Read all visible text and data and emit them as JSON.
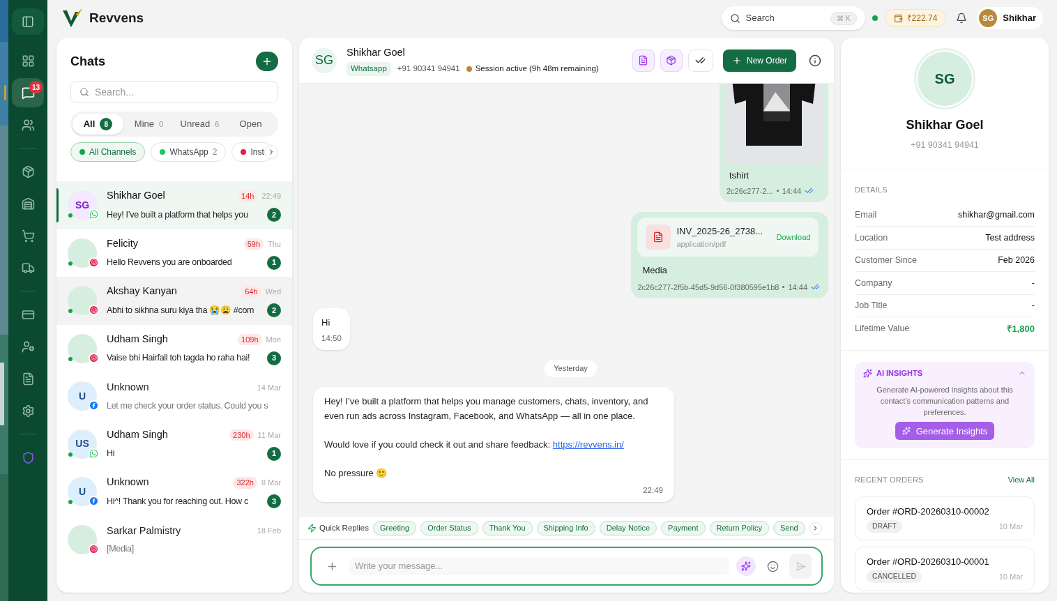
{
  "brand": {
    "name": "Revvens"
  },
  "nav": {
    "groups": [
      [
        {
          "kind": "dashboard",
          "selected": false
        },
        {
          "kind": "chats",
          "selected": true,
          "badge": "13"
        },
        {
          "kind": "contacts",
          "selected": false
        }
      ],
      [
        {
          "kind": "products",
          "selected": false
        },
        {
          "kind": "warehouse",
          "selected": false
        },
        {
          "kind": "cart",
          "selected": false
        },
        {
          "kind": "delivery",
          "selected": false
        }
      ],
      [
        {
          "kind": "billing",
          "selected": false
        },
        {
          "kind": "team",
          "selected": false
        },
        {
          "kind": "documents",
          "selected": false
        },
        {
          "kind": "settings",
          "selected": false
        }
      ],
      [
        {
          "kind": "security",
          "selected": false
        }
      ]
    ]
  },
  "topbar": {
    "search": {
      "placeholder": "Search",
      "shortcut": "⌘ K"
    },
    "balance": "₹222.74",
    "user": {
      "initials": "SG",
      "name": "Shikhar"
    }
  },
  "chats": {
    "title": "Chats",
    "search": {
      "placeholder": "Search..."
    },
    "filters": [
      {
        "label": "All",
        "count": "8",
        "selected": true
      },
      {
        "label": "Mine",
        "count": "0",
        "selected": false
      },
      {
        "label": "Unread",
        "count": "6",
        "selected": false
      },
      {
        "label": "Open",
        "selected": false
      }
    ],
    "channels": [
      {
        "label": "All Channels",
        "color": "#16a34a",
        "selected": true
      },
      {
        "label": "WhatsApp",
        "count": "2",
        "color": "#22c55e",
        "selected": false
      },
      {
        "label": "Inst",
        "color": "#e11d48",
        "selected": false
      }
    ],
    "conversations": [
      {
        "initials": "SG",
        "color": "#f3e8ff",
        "name": "Shikhar Goel",
        "age": "14h",
        "time": "22:49",
        "preview": "Hey! I’ve built a platform that helps you",
        "unread": "2",
        "kind": "whatsapp",
        "online": true,
        "selected": true,
        "highlighted": false
      },
      {
        "color": "#d6eee0",
        "name": "Felicity",
        "age": "59h",
        "time": "Thu",
        "preview": "Hello Revvens you are onboarded",
        "unread": "1",
        "kind": "instagram",
        "online": true,
        "selected": false,
        "highlighted": false
      },
      {
        "color": "#d6eee0",
        "name": "Akshay Kanyan",
        "age": "64h",
        "time": "Wed",
        "preview": "Abhi to sikhna suru kiya tha 😭😩 #com",
        "unread": "2",
        "kind": "instagram",
        "online": true,
        "selected": false,
        "highlighted": true
      },
      {
        "color": "#d6eee0",
        "name": "Udham Singh",
        "age": "109h",
        "time": "Mon",
        "preview": "Vaise bhi Hairfall toh tagda ho raha hai!",
        "unread": "3",
        "kind": "instagram",
        "online": true,
        "selected": false,
        "highlighted": false
      },
      {
        "initials": "U",
        "color": "#ddeefc",
        "name": "Unknown",
        "time": "14 Mar",
        "preview": "Let me check your order status. Could you s",
        "kind": "facebook",
        "online": false,
        "selected": false,
        "highlighted": false
      },
      {
        "initials": "US",
        "color": "#ddeefc",
        "name": "Udham Singh",
        "age": "230h",
        "time": "11 Mar",
        "preview": "Hi",
        "unread": "1",
        "kind": "whatsapp",
        "online": true,
        "selected": false,
        "highlighted": false
      },
      {
        "initials": "U",
        "color": "#ddeefc",
        "name": "Unknown",
        "age": "322h",
        "time": "8 Mar",
        "preview": "Hi^! Thank you for reaching out. How c",
        "unread": "3",
        "kind": "facebook",
        "online": true,
        "selected": false,
        "highlighted": false
      },
      {
        "color": "#d6eee0",
        "name": "Sarkar Palmistry",
        "time": "18 Feb",
        "preview": "[Media]",
        "kind": "instagram",
        "online": false,
        "selected": false,
        "highlighted": false
      }
    ]
  },
  "conversation": {
    "initials": "SG",
    "name": "Shikhar Goel",
    "channel": "Whatsapp",
    "phone": "+91 90341 94941",
    "session": "Session active (9h 48m remaining)",
    "new_order": "New Order",
    "messages": [
      {
        "caption": "tshirt",
        "ref": "2c26c277-2...",
        "time": "14:44",
        "read": true
      },
      {
        "kind": "file",
        "file_name": "INV_2025-26_2738...",
        "mime": "application/pdf",
        "action": "Download",
        "caption": "Media",
        "ref": "2c26c277-2f5b-45d5-9d56-0f380595e1b8",
        "time": "14:44",
        "read": true
      },
      {
        "kind": "incoming",
        "paragraphs": [
          {
            "text": "Hi"
          }
        ],
        "time": "14:50"
      },
      {
        "kind": "date",
        "label": "Yesterday"
      },
      {
        "kind": "incoming",
        "paragraphs": [
          {
            "text": "Hey! I’ve built a platform that helps you manage customers, chats, inventory, and even run ads across Instagram, Facebook, and WhatsApp — all in one place."
          },
          {
            "text": "Would love if you could check it out and share feedback: ",
            "link": "https://revvens.in/"
          },
          {
            "text": "No pressure 🙂"
          }
        ],
        "time": "22:49"
      }
    ],
    "quick_replies": {
      "label": "Quick Replies",
      "items": [
        "Greeting",
        "Order Status",
        "Thank You",
        "Shipping Info",
        "Delay Notice",
        "Payment",
        "Return Policy",
        "Send"
      ]
    },
    "composer": {
      "placeholder": "Write your message..."
    }
  },
  "contact": {
    "initials": "SG",
    "name": "Shikhar Goel",
    "phone": "+91 90341 94941",
    "details_title": "DETAILS",
    "details": [
      {
        "label": "Email",
        "value": "shikhar@gmail.com",
        "emphasis": false
      },
      {
        "label": "Location",
        "value": "Test address",
        "emphasis": false
      },
      {
        "label": "Customer Since",
        "value": "Feb 2026",
        "emphasis": false
      },
      {
        "label": "Company",
        "value": "-",
        "emphasis": false
      },
      {
        "label": "Job Title",
        "value": "-",
        "emphasis": false
      },
      {
        "label": "Lifetime Value",
        "value": "₹1,800",
        "emphasis": true
      }
    ],
    "insights": {
      "title": "AI INSIGHTS",
      "expanded": true,
      "text": "Generate AI-powered insights about this contact’s communication patterns and preferences.",
      "button": "Generate Insights"
    },
    "orders_title": "RECENT ORDERS",
    "view_all": "View All",
    "orders": [
      {
        "number": "Order #ORD-20260310-00002",
        "status": "DRAFT",
        "date": "10 Mar"
      },
      {
        "number": "Order #ORD-20260310-00001",
        "status": "CANCELLED",
        "date": "10 Mar"
      }
    ]
  }
}
